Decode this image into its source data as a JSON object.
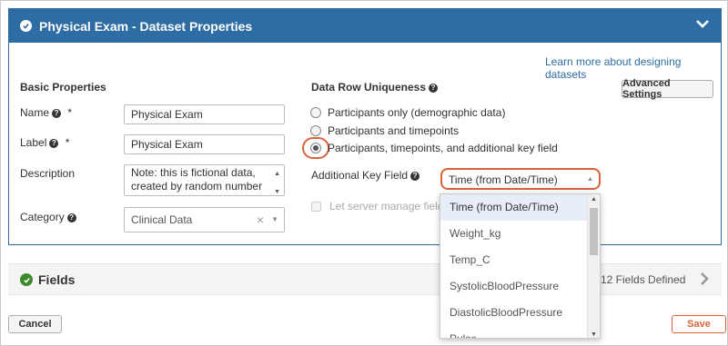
{
  "panel": {
    "title": "Physical Exam - Dataset Properties",
    "learn_more_link": "Learn more about designing datasets"
  },
  "basic": {
    "heading": "Basic Properties",
    "name_label": "Name",
    "name_required": "*",
    "name_value": "Physical Exam",
    "label_label": "Label",
    "label_required": "*",
    "label_value": "Physical Exam",
    "description_label": "Description",
    "description_line1": "Note: this is fictional data,",
    "description_line2": "created by random number",
    "category_label": "Category",
    "category_value": "Clinical Data",
    "category_clear": "×"
  },
  "uniqueness": {
    "heading": "Data Row Uniqueness",
    "advanced_button": "Advanced Settings",
    "options": [
      "Participants only (demographic data)",
      "Participants and timepoints",
      "Participants, timepoints, and additional key field"
    ],
    "selected_index": 2,
    "additional_key_label": "Additional Key Field",
    "additional_key_value": "Time (from Date/Time)",
    "server_manage_label": "Let server manage fields"
  },
  "dropdown": {
    "options": [
      "Time (from Date/Time)",
      "Weight_kg",
      "Temp_C",
      "SystolicBloodPressure",
      "DiastolicBloodPressure",
      "Pulse"
    ]
  },
  "fields": {
    "title": "Fields",
    "count_text": "12 Fields Defined"
  },
  "footer": {
    "cancel_label": "Cancel",
    "save_label": "Save"
  },
  "colors": {
    "header_blue": "#2e6da4",
    "highlight_orange": "#d9623b",
    "success_green": "#3c8a2e"
  }
}
